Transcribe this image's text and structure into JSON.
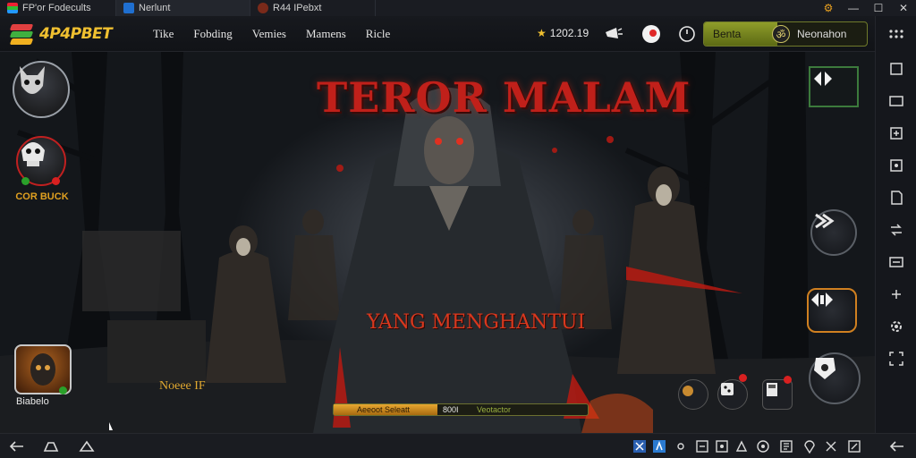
{
  "window": {
    "tabs": [
      {
        "label": "FP'or Fodecults",
        "icon": "app-stack-icon"
      },
      {
        "label": "Nerlunt",
        "icon": "window-icon"
      },
      {
        "label": "R44 IPebxt",
        "icon": "game-icon"
      }
    ],
    "controls": [
      "gear-icon",
      "minimize-icon",
      "maximize-icon",
      "close-icon"
    ]
  },
  "topbar": {
    "logo_text": "4P4PBET",
    "nav": [
      "Tike",
      "Fobding",
      "Vemies",
      "Mamens",
      "Ricle"
    ],
    "coins_star": "★",
    "coins_value": "1202.19",
    "balance_left": "Benta",
    "balance_badge": "ॐ",
    "balance_right": "Neonahon"
  },
  "scene": {
    "title_main": "TEROR MALAM",
    "title_sub": "YANG MENGHANTUI",
    "left_label": "Noeee IF",
    "boss_caption": "COR BUCK",
    "player_name": "Biabelo",
    "loadbar": {
      "segment1": "Aeeoot Seleatt",
      "segment2": "800I",
      "segment3": "Veotactor"
    }
  },
  "colors": {
    "accent_gold": "#f0c030",
    "blood_red": "#c0201a",
    "panel_green": "#8f9d2a"
  }
}
